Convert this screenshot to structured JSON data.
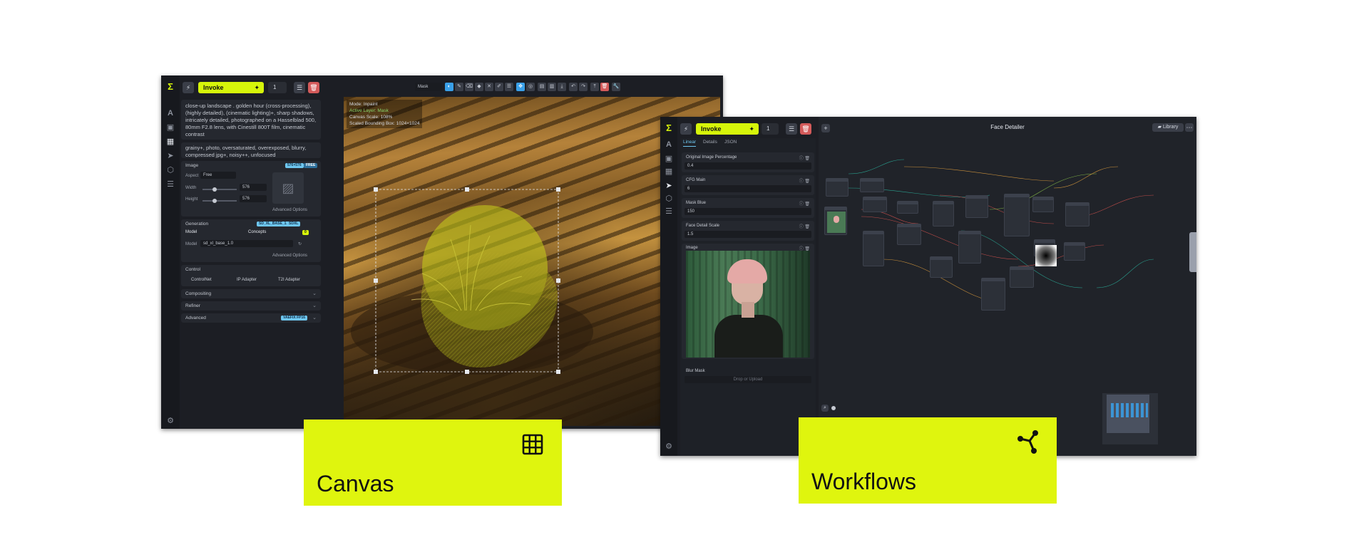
{
  "canvas_window": {
    "invoke_label": "Invoke",
    "iterations": "1",
    "positive_prompt": "close-up landscape . golden hour (cross-processing), (highly detailed), (cinematic lighting)+, sharp shadows, intricately detailed, photographed on a Hasselblad 500, 80mm F2.8 lens, with Cinestill 800T film, cinematic contrast",
    "negative_prompt": "grainy+, photo, oversaturated, overexposed, blurry, compressed jpg+, noisy++, unfocused",
    "image_section": {
      "title": "Image",
      "badges": [
        "576×576",
        "FREE"
      ],
      "aspect_label": "Aspect",
      "aspect_value": "Free",
      "width_label": "Width",
      "width_value": "576",
      "height_label": "Height",
      "height_value": "576",
      "advanced_options": "Advanced Options"
    },
    "generation_section": {
      "title": "Generation",
      "badges": [
        "SD_XL_BASE_1.0",
        "SDXL"
      ],
      "tabs": [
        "Model",
        "Concepts"
      ],
      "concepts_count": "0",
      "model_label": "Model",
      "model_value": "sd_xl_base_1.0",
      "advanced_options": "Advanced Options"
    },
    "control_section": {
      "title": "Control",
      "buttons": [
        "ControlNet",
        "IP Adapter",
        "T2I Adapter"
      ]
    },
    "collapsed_sections": [
      {
        "title": "Compositing",
        "badge": ""
      },
      {
        "title": "Refiner",
        "badge": ""
      },
      {
        "title": "Advanced",
        "badge": "VAEFIX FP16"
      }
    ],
    "mask_select": "Mask",
    "canvas_info": {
      "mode": "Mode: Inpaint",
      "layer": "Active Layer: Mask",
      "scale": "Canvas Scale: 108%",
      "bbox": "Scaled Bounding Box: 1024×1024"
    }
  },
  "workflow_window": {
    "invoke_label": "Invoke",
    "iterations": "1",
    "title": "Face Detailer",
    "library_label": "Library",
    "tabs": [
      "Linear",
      "Details",
      "JSON"
    ],
    "fields": [
      {
        "label": "Original Image Percentage",
        "value": "0.4"
      },
      {
        "label": "CFG Main",
        "value": "6"
      },
      {
        "label": "Mask Blue",
        "value": "150"
      },
      {
        "label": "Face Detail Scale",
        "value": "1.5"
      }
    ],
    "image_label": "Image",
    "blur_mask_label": "Blur Mask",
    "drop_upload": "Drop or Upload"
  },
  "tags": [
    {
      "label": "Canvas",
      "icon": "grid-icon"
    },
    {
      "label": "Workflows",
      "icon": "share-nodes-icon"
    }
  ],
  "colors": {
    "accent": "#dff50e",
    "panel": "#1c1e24",
    "badge": "#6ec6ef"
  }
}
